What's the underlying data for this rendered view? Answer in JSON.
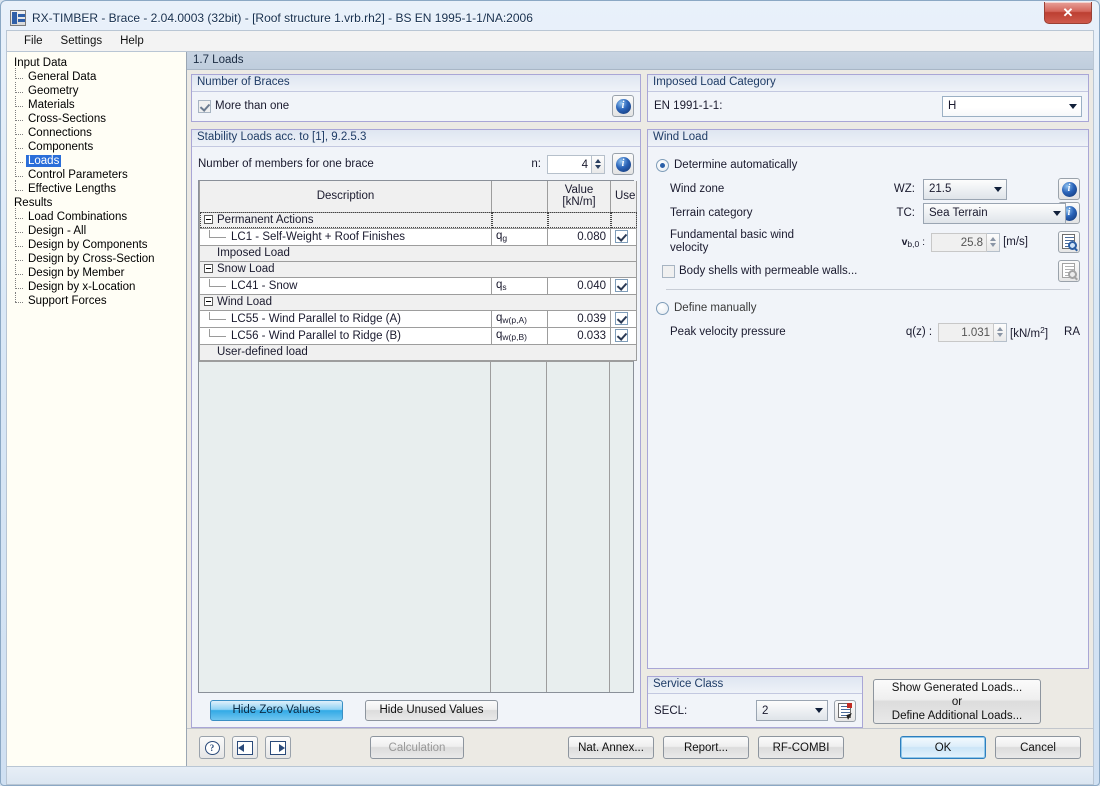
{
  "window": {
    "title": "RX-TIMBER - Brace - 2.04.0003 (32bit) - [Roof structure 1.vrb.rh2] - BS EN 1995-1-1/NA:2006",
    "close_label": "✕"
  },
  "menu": {
    "items": [
      "File",
      "Settings",
      "Help"
    ]
  },
  "tree": {
    "groups": [
      {
        "label": "Input Data",
        "items": [
          "General Data",
          "Geometry",
          "Materials",
          "Cross-Sections",
          "Connections",
          "Components",
          "Loads",
          "Control Parameters",
          "Effective Lengths"
        ],
        "selected": "Loads"
      },
      {
        "label": "Results",
        "items": [
          "Load Combinations",
          "Design - All",
          "Design by Components",
          "Design by Cross-Section",
          "Design by Member",
          "Design by x-Location",
          "Support Forces"
        ],
        "selected": ""
      }
    ]
  },
  "page": {
    "title": "1.7 Loads"
  },
  "number_of_braces": {
    "header": "Number of Braces",
    "checkbox_label": "More than one",
    "checkbox_checked": true,
    "info_icon": "info-icon"
  },
  "stability_loads": {
    "header": "Stability Loads acc. to [1], 9.2.5.3",
    "members_label": "Number of members for one brace",
    "members_prefix": "n:",
    "members_value": "4",
    "info_icon": "info-icon",
    "table": {
      "columns": [
        "Description",
        "",
        "Value\n[kN/m]",
        "Use"
      ],
      "col_description": "Description",
      "col_value_1": "Value",
      "col_value_2": "[kN/m]",
      "col_use": "Use",
      "rows": [
        {
          "kind": "group",
          "expander": true,
          "description": "Permanent Actions",
          "symbol": "",
          "value": "",
          "use": null,
          "selected": true
        },
        {
          "kind": "item",
          "description": "LC1 - Self-Weight + Roof Finishes",
          "symbol_main": "q",
          "symbol_sub": "g",
          "value": "0.080",
          "use": true
        },
        {
          "kind": "group",
          "expander": false,
          "description": "Imposed Load",
          "symbol": "",
          "value": "",
          "use": null
        },
        {
          "kind": "group",
          "expander": true,
          "description": "Snow Load",
          "symbol": "",
          "value": "",
          "use": null
        },
        {
          "kind": "item",
          "description": "LC41 - Snow",
          "symbol_main": "q",
          "symbol_sub": "s",
          "value": "0.040",
          "use": true
        },
        {
          "kind": "group",
          "expander": true,
          "description": "Wind Load",
          "symbol": "",
          "value": "",
          "use": null
        },
        {
          "kind": "item",
          "description": "LC55 - Wind Parallel to Ridge (A)",
          "symbol_main": "q",
          "symbol_sub": "w(p,A)",
          "value": "0.039",
          "use": true
        },
        {
          "kind": "item",
          "description": "LC56 - Wind Parallel to Ridge (B)",
          "symbol_main": "q",
          "symbol_sub": "w(p,B)",
          "value": "0.033",
          "use": true
        },
        {
          "kind": "group",
          "expander": false,
          "description": "User-defined load",
          "symbol": "",
          "value": "",
          "use": null
        }
      ]
    },
    "hide_zero_label": "Hide Zero Values",
    "hide_unused_label": "Hide Unused Values"
  },
  "imposed_load_category": {
    "header": "Imposed Load Category",
    "field_label": "EN 1991-1-1:",
    "value": "H"
  },
  "wind_load": {
    "header": "Wind Load",
    "auto_radio_label": "Determine automatically",
    "auto_selected": true,
    "wind_zone_label": "Wind zone",
    "wind_zone_prefix": "WZ:",
    "wind_zone_value": "21.5",
    "terrain_label": "Terrain category",
    "terrain_prefix": "TC:",
    "terrain_value": "Sea Terrain",
    "vb_label_line1": "Fundamental basic wind",
    "vb_label_line2": "velocity",
    "vb_symbol": "v",
    "vb_sub": "b,0",
    "vb_colon": ":",
    "vb_value": "25.8",
    "vb_unit": "[m/s]",
    "permeable_label": "Body shells with permeable walls...",
    "permeable_checked": false,
    "manual_radio_label": "Define manually",
    "manual_selected": false,
    "qz_label": "Peak velocity pressure",
    "qz_prefix": "q(z) :",
    "qz_value": "1.031",
    "qz_unit_pre": "[kN/m",
    "qz_unit_sup": "2",
    "qz_unit_post": "]",
    "qz_suffix": "RA"
  },
  "service_class": {
    "header": "Service Class",
    "label": "SECL:",
    "value": "2",
    "icon": "document-cursor-icon"
  },
  "generated_loads_button": {
    "line1": "Show Generated Loads...",
    "line2": "or",
    "line3": "Define Additional Loads..."
  },
  "bottom_bar": {
    "help_icon": "help-bubble-icon",
    "prev_icon": "nav-previous-icon",
    "next_icon": "nav-next-icon",
    "calculation_label": "Calculation",
    "calculation_disabled": true,
    "nat_annex_label": "Nat. Annex...",
    "report_label": "Report...",
    "rf_combi_label": "RF-COMBI",
    "ok_label": "OK",
    "cancel_label": "Cancel"
  },
  "colors": {
    "accent_blue": "#2a6ed9",
    "group_border": "#a9a6d6",
    "table_empty": "#e8eeee",
    "title_close": "#bc3f32"
  }
}
